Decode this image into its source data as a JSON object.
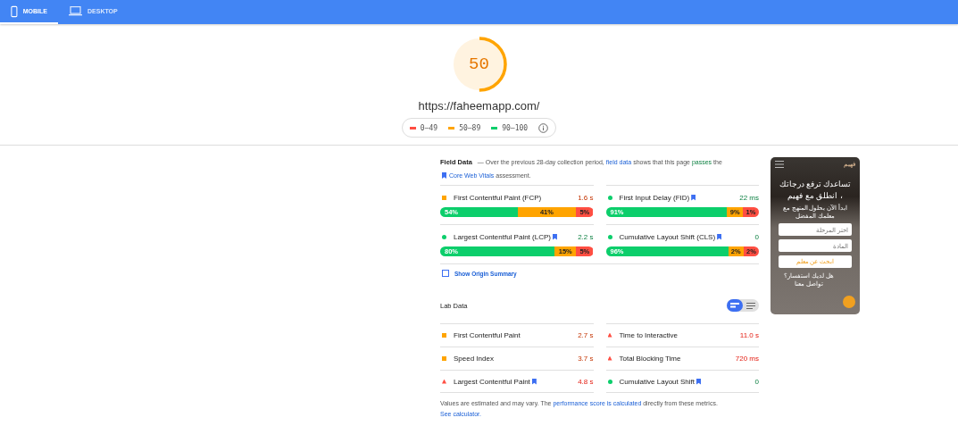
{
  "tabs": [
    {
      "label": "MOBILE",
      "selected": true
    },
    {
      "label": "DESKTOP",
      "selected": false
    }
  ],
  "score": {
    "value": "50",
    "level": 0.5,
    "url": "https://faheemapp.com/"
  },
  "legend": [
    {
      "label": "0–49",
      "color": "#ff4e42"
    },
    {
      "label": "50–89",
      "color": "#ffa400"
    },
    {
      "label": "90–100",
      "color": "#0cce6b"
    }
  ],
  "field_data": {
    "title": "Field Data",
    "desc_before": "— Over the previous 28-day collection period,",
    "link": "field data",
    "desc_mid": "shows that this page",
    "verdict": "passes",
    "desc_after": "the",
    "cwv_link": "Core Web Vitals",
    "desc_end": "assessment.",
    "metrics": [
      {
        "name": "First Contentful Paint (FCP)",
        "kind": "average",
        "bookmark": false,
        "value": "1.6 s",
        "segments": [
          {
            "kind": "good",
            "label": "54%"
          },
          {
            "kind": "average",
            "label": "41%"
          },
          {
            "kind": "poor",
            "label": "5%"
          }
        ]
      },
      {
        "name": "First Input Delay (FID)",
        "kind": "pass",
        "bookmark": true,
        "value": "22 ms",
        "segments": [
          {
            "kind": "good",
            "label": "91%"
          },
          {
            "kind": "average",
            "label": "9%"
          },
          {
            "kind": "poor",
            "label": "1%"
          }
        ]
      },
      {
        "name": "Largest Contentful Paint (LCP)",
        "kind": "pass",
        "bookmark": true,
        "value": "2.2 s",
        "segments": [
          {
            "kind": "good",
            "label": "80%"
          },
          {
            "kind": "average",
            "label": "15%"
          },
          {
            "kind": "poor",
            "label": "5%"
          }
        ]
      },
      {
        "name": "Cumulative Layout Shift (CLS)",
        "kind": "pass",
        "bookmark": true,
        "value": "0",
        "segments": [
          {
            "kind": "good",
            "label": "96%"
          },
          {
            "kind": "average",
            "label": "2%"
          },
          {
            "kind": "poor",
            "label": "2%"
          }
        ]
      }
    ],
    "origin_summary": {
      "label": "Show Origin Summary",
      "checked": false
    }
  },
  "lab_data": {
    "title": "Lab Data",
    "views": [
      {
        "selected": true
      },
      {
        "selected": false
      }
    ],
    "metrics": [
      {
        "name": "First Contentful Paint",
        "kind": "average",
        "bookmark": false,
        "value": "2.7 s"
      },
      {
        "name": "Time to Interactive",
        "kind": "fail",
        "bookmark": false,
        "value": "11.0 s"
      },
      {
        "name": "Speed Index",
        "kind": "average",
        "bookmark": false,
        "value": "3.7 s"
      },
      {
        "name": "Total Blocking Time",
        "kind": "fail",
        "bookmark": false,
        "value": "720 ms"
      },
      {
        "name": "Largest Contentful Paint",
        "kind": "fail",
        "bookmark": true,
        "value": "4.8 s"
      },
      {
        "name": "Cumulative Layout Shift",
        "kind": "pass",
        "bookmark": true,
        "value": "0"
      }
    ],
    "note_before": "Values are estimated and may vary. The",
    "note_link": "performance score is calculated",
    "note_after": "directly from these metrics.",
    "calc_link": "See calculator."
  },
  "phone_preview": {
    "logo": "فهيم",
    "headline": "تساعدك ترفع درجاتك ، انطلق مع فهيم",
    "subtitle": "ابدأ الآن بحلول المنهج مع معلمك المفضل",
    "fields": [
      {
        "placeholder": "اختر المرحلة"
      },
      {
        "placeholder": "المادة"
      }
    ],
    "button": "ابحث عن معلم",
    "footer": "هل لديك استفسار؟ تواصل معنا"
  }
}
